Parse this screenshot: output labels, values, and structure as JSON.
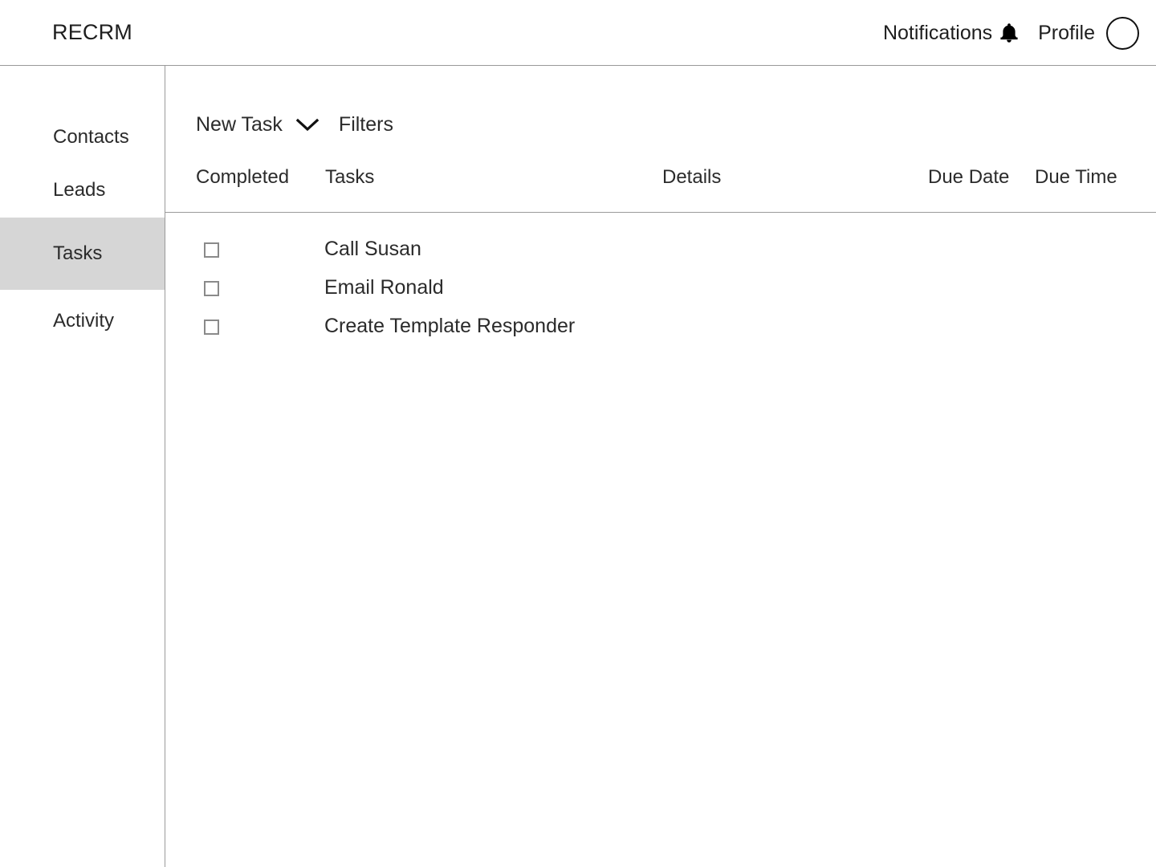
{
  "app": {
    "brand": "RECRM"
  },
  "header": {
    "notifications_label": "Notifications",
    "notifications_icon": "bell-icon",
    "profile_label": "Profile",
    "avatar_icon": "avatar-circle-icon"
  },
  "sidebar": {
    "items": [
      {
        "label": "Contacts",
        "active": false
      },
      {
        "label": "Leads",
        "active": false
      },
      {
        "label": "Tasks",
        "active": true
      },
      {
        "label": "Activity",
        "active": false
      }
    ],
    "active_background": "#d6d6d6"
  },
  "toolbar": {
    "new_task_label": "New Task",
    "new_task_icon": "chevron-down-icon",
    "filters_label": "Filters"
  },
  "table": {
    "columns": [
      "Completed",
      "Tasks",
      "Details",
      "Due Date",
      "Due Time"
    ],
    "rows": [
      {
        "completed": false,
        "task": "Call Susan",
        "details": "",
        "due_date": "",
        "due_time": ""
      },
      {
        "completed": false,
        "task": "Email Ronald",
        "details": "",
        "due_date": "",
        "due_time": ""
      },
      {
        "completed": false,
        "task": "Create Template Responder",
        "details": "",
        "due_date": "",
        "due_time": ""
      }
    ]
  },
  "colors": {
    "background": "#ffffff",
    "text": "#2b2b2b",
    "border": "#9a9a9a",
    "checkbox_border": "#8a8a8a",
    "active_nav": "#d6d6d6"
  }
}
